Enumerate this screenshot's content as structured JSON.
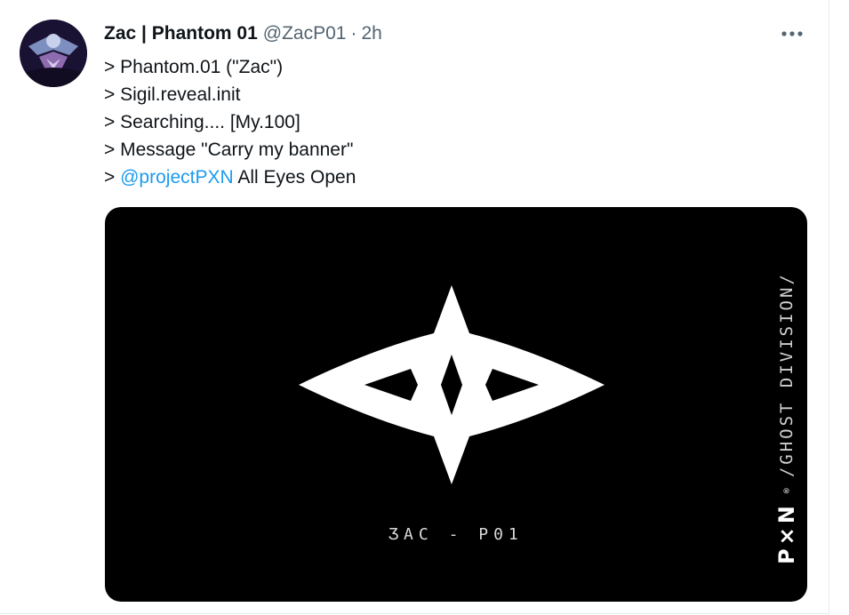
{
  "tweet": {
    "display_name": "Zac | Phantom 01",
    "handle": "@ZacP01",
    "separator": "·",
    "time": "2h",
    "more_icon": "more-horizontal-icon",
    "lines": [
      "> Phantom.01 (\"Zac\")",
      "> Sigil.reveal.init",
      "> Searching.... [My.100]",
      "> Message \"Carry my banner\""
    ],
    "last_line_prefix": "> ",
    "mention": "@projectPXN",
    "last_line_suffix": " All Eyes Open"
  },
  "media": {
    "caption": "ƷAC - P01",
    "brand": "P×N",
    "registered": "®",
    "division_text": "/GHOST DIVISION/",
    "background": "#000000",
    "sigil_color": "#ffffff"
  },
  "colors": {
    "link": "#1d9bf0",
    "secondary_text": "#536471",
    "primary_text": "#0f1419"
  }
}
